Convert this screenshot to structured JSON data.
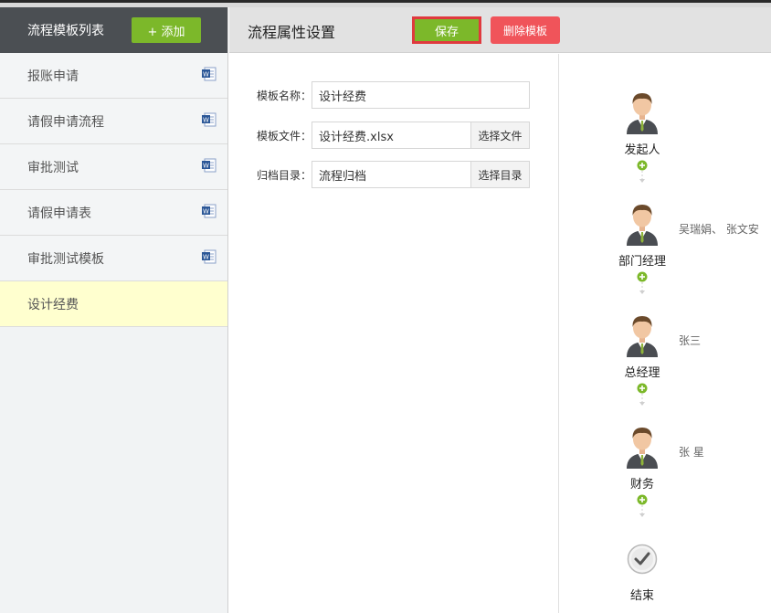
{
  "sidebar": {
    "title": "流程模板列表",
    "add_label": "+ 添加",
    "items": [
      {
        "label": "报账申请"
      },
      {
        "label": "请假申请流程"
      },
      {
        "label": "审批测试"
      },
      {
        "label": "请假申请表"
      },
      {
        "label": "审批测试模板"
      },
      {
        "label": "设计经费"
      }
    ]
  },
  "header": {
    "title": "流程属性设置",
    "save_label": "保存",
    "delete_label": "删除模板"
  },
  "form": {
    "name_label": "模板名称：",
    "name_value": "设计经费",
    "file_label": "模板文件：",
    "file_value": "设计经费.xlsx",
    "file_button": "选择文件",
    "dir_label": "归档目录：",
    "dir_value": "流程归档",
    "dir_button": "选择目录"
  },
  "flow": {
    "nodes": [
      {
        "label": "发起人",
        "assignee": ""
      },
      {
        "label": "部门经理",
        "assignee": "吴瑞娟、 张文安"
      },
      {
        "label": "总经理",
        "assignee": "张三"
      },
      {
        "label": "财务",
        "assignee": "张 星"
      }
    ],
    "end_label": "结束"
  },
  "colors": {
    "green": "#7cb82a",
    "red": "#f0545a",
    "sidebar_header": "#4b4f53",
    "active_item": "#ffffcf"
  }
}
